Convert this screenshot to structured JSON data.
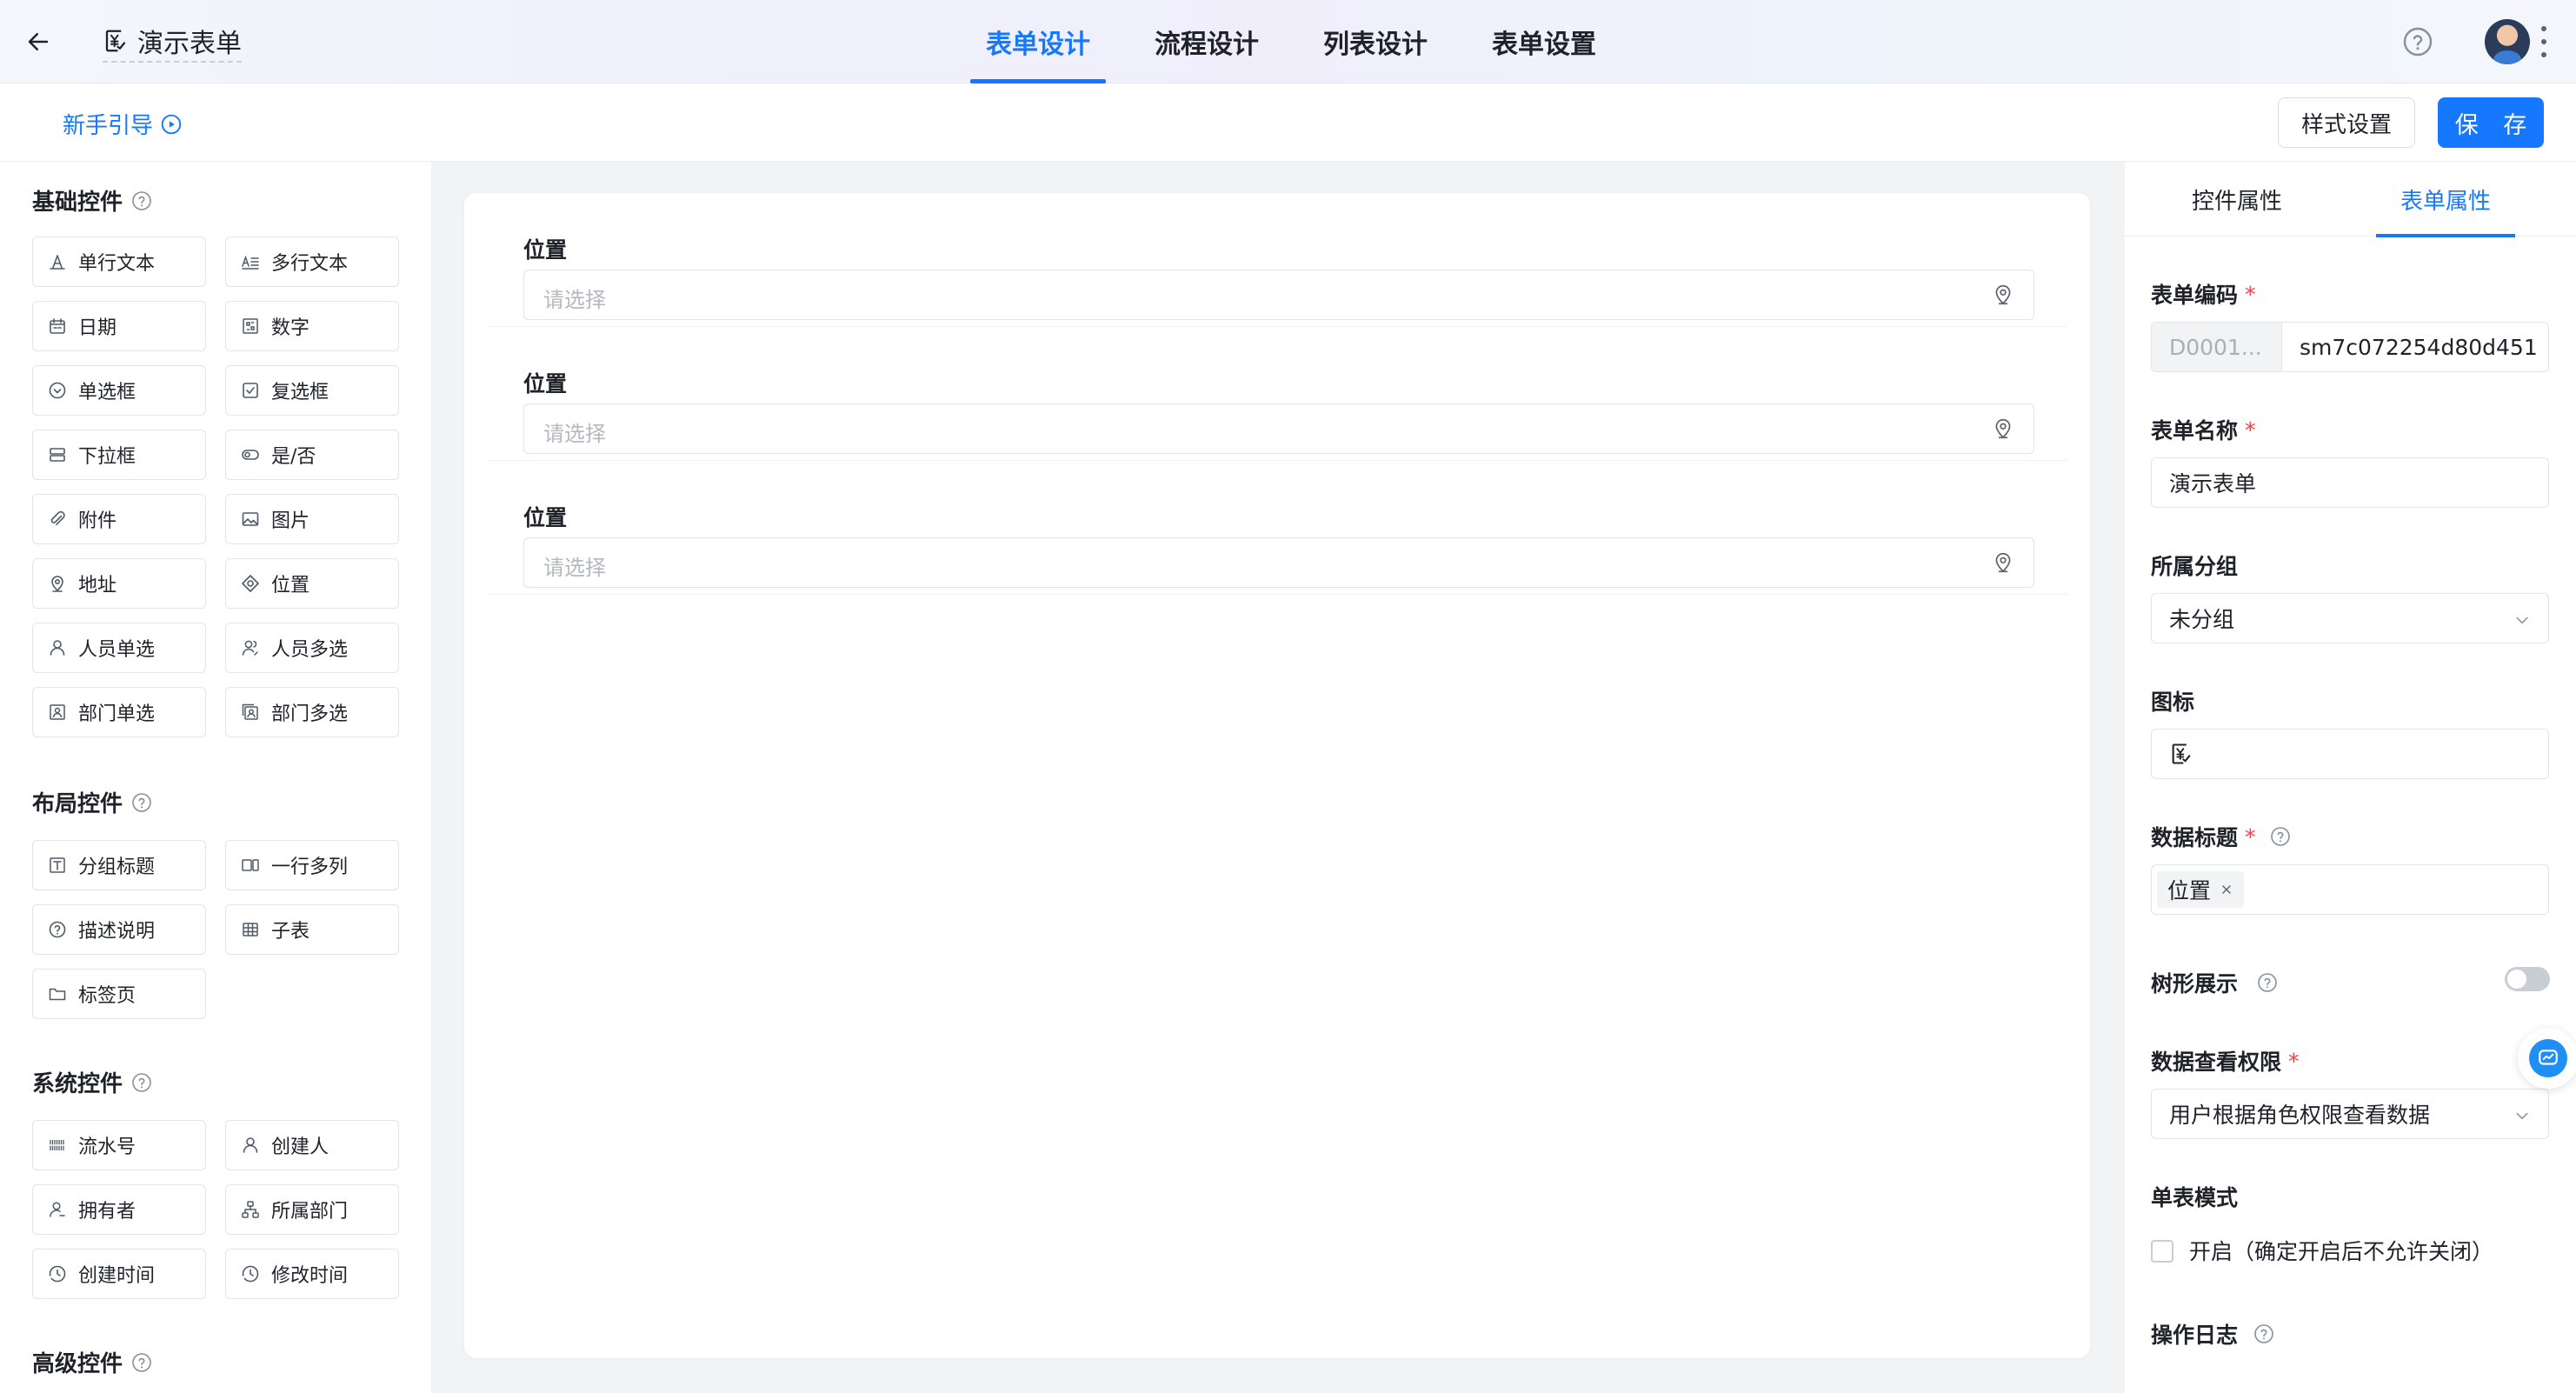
{
  "header": {
    "title": "演示表单",
    "tabs": [
      {
        "label": "表单设计",
        "active": true
      },
      {
        "label": "流程设计",
        "active": false
      },
      {
        "label": "列表设计",
        "active": false
      },
      {
        "label": "表单设置",
        "active": false
      }
    ]
  },
  "toolbar": {
    "guide_label": "新手引导",
    "style_label": "样式设置",
    "save_label": "保 存"
  },
  "left_panel": {
    "basic": {
      "title": "基础控件",
      "items": [
        {
          "label": "单行文本",
          "icon": "single-line-text-icon"
        },
        {
          "label": "多行文本",
          "icon": "multi-line-text-icon"
        },
        {
          "label": "日期",
          "icon": "calendar-icon"
        },
        {
          "label": "数字",
          "icon": "number-icon"
        },
        {
          "label": "单选框",
          "icon": "radio-icon"
        },
        {
          "label": "复选框",
          "icon": "checkbox-icon"
        },
        {
          "label": "下拉框",
          "icon": "dropdown-icon"
        },
        {
          "label": "是/否",
          "icon": "switch-icon"
        },
        {
          "label": "附件",
          "icon": "paperclip-icon"
        },
        {
          "label": "图片",
          "icon": "image-icon"
        },
        {
          "label": "地址",
          "icon": "address-pin-icon"
        },
        {
          "label": "位置",
          "icon": "location-target-icon"
        },
        {
          "label": "人员单选",
          "icon": "user-icon"
        },
        {
          "label": "人员多选",
          "icon": "users-icon"
        },
        {
          "label": "部门单选",
          "icon": "department-icon"
        },
        {
          "label": "部门多选",
          "icon": "departments-icon"
        }
      ]
    },
    "layout": {
      "title": "布局控件",
      "items": [
        {
          "label": "分组标题",
          "icon": "group-title-icon"
        },
        {
          "label": "一行多列",
          "icon": "columns-icon"
        },
        {
          "label": "描述说明",
          "icon": "description-icon"
        },
        {
          "label": "子表",
          "icon": "table-icon"
        },
        {
          "label": "标签页",
          "icon": "folder-tab-icon"
        }
      ]
    },
    "system": {
      "title": "系统控件",
      "items": [
        {
          "label": "流水号",
          "icon": "serial-number-icon"
        },
        {
          "label": "创建人",
          "icon": "creator-icon"
        },
        {
          "label": "拥有者",
          "icon": "owner-icon"
        },
        {
          "label": "所属部门",
          "icon": "org-chart-icon"
        },
        {
          "label": "创建时间",
          "icon": "clock-icon"
        },
        {
          "label": "修改时间",
          "icon": "clock-edit-icon"
        }
      ]
    },
    "advanced": {
      "title": "高级控件"
    }
  },
  "canvas": {
    "fields": [
      {
        "label": "位置",
        "placeholder": "请选择"
      },
      {
        "label": "位置",
        "placeholder": "请选择"
      },
      {
        "label": "位置",
        "placeholder": "请选择"
      }
    ]
  },
  "right_panel": {
    "tabs": [
      {
        "label": "控件属性",
        "active": false
      },
      {
        "label": "表单属性",
        "active": true
      }
    ],
    "form_code": {
      "label": "表单编码",
      "prefix": "D0001...",
      "value": "sm7c072254d80d451"
    },
    "form_name": {
      "label": "表单名称",
      "value": "演示表单"
    },
    "group": {
      "label": "所属分组",
      "value": "未分组"
    },
    "icon": {
      "label": "图标"
    },
    "data_title": {
      "label": "数据标题",
      "tag": "位置"
    },
    "tree_view": {
      "label": "树形展示",
      "enabled": false
    },
    "view_permission": {
      "label": "数据查看权限",
      "value": "用户根据角色权限查看数据"
    },
    "single_mode": {
      "label": "单表模式",
      "checkbox_label": "开启（确定开启后不允许关闭）",
      "checked": false
    },
    "operation_log": {
      "label": "操作日志"
    }
  },
  "colors": {
    "accent": "#1677ff",
    "required": "#f53f3f",
    "text": "#1f2329",
    "placeholder": "#b4b8bf"
  }
}
